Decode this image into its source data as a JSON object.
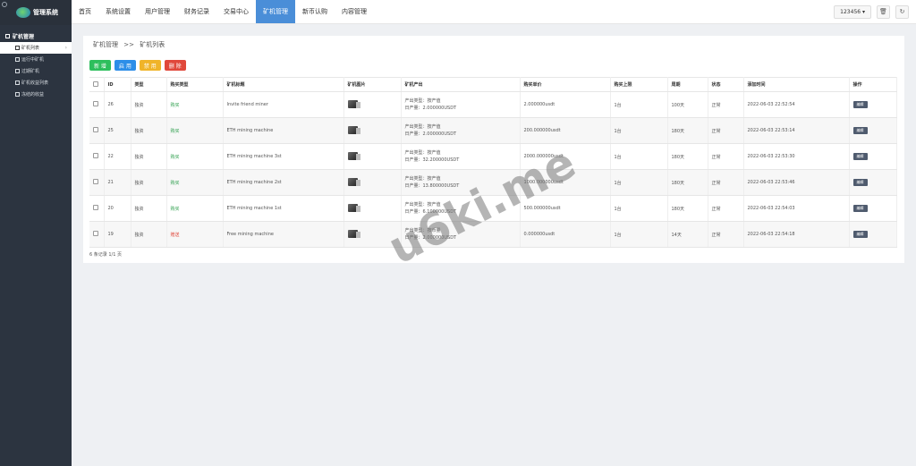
{
  "brand": {
    "title": "管理系统"
  },
  "sidebar": {
    "group": "矿机管理",
    "items": [
      {
        "label": "矿机列表",
        "active": true
      },
      {
        "label": "运行中矿机"
      },
      {
        "label": "过期矿机"
      },
      {
        "label": "矿机收益列表"
      },
      {
        "label": "冻结的收益"
      }
    ]
  },
  "topnav": {
    "items": [
      "首页",
      "系统设置",
      "用户管理",
      "财务记录",
      "交易中心",
      "矿机管理",
      "新币认购",
      "内容管理"
    ],
    "active_index": 5,
    "user": "123456 ▾"
  },
  "breadcrumb": {
    "root": "矿机管理",
    "sep": ">>",
    "current": "矿机列表"
  },
  "buttons": {
    "add": "新 增",
    "enable": "启 用",
    "disable": "禁 用",
    "delete": "删 除"
  },
  "table": {
    "headers": [
      "ID",
      "类型",
      "购买类型",
      "矿机标题",
      "矿机图片",
      "矿机产出",
      "购买单价",
      "购买上限",
      "周期",
      "状态",
      "添加时间",
      "操作"
    ],
    "rows": [
      {
        "id": "26",
        "type": "独资",
        "buy_type": "购买",
        "buy_color": "green",
        "title": "Invite friend miner",
        "out_kind": "产出类型：按产值",
        "out_daily": "日产量：2.000000USDT",
        "price": "2.000000usdt",
        "limit": "1台",
        "period": "100天",
        "status": "正常",
        "time": "2022-06-03 22:52:54",
        "action": "编辑"
      },
      {
        "id": "25",
        "type": "独资",
        "buy_type": "购买",
        "buy_color": "green",
        "title": "ETH mining machine",
        "out_kind": "产出类型：按产值",
        "out_daily": "日产量：2.000000USDT",
        "price": "200.000000usdt",
        "limit": "1台",
        "period": "180天",
        "status": "正常",
        "time": "2022-06-03 22:53:14",
        "action": "编辑"
      },
      {
        "id": "22",
        "type": "独资",
        "buy_type": "购买",
        "buy_color": "green",
        "title": "ETH mining machine 3st",
        "out_kind": "产出类型：按产值",
        "out_daily": "日产量：32.200000USDT",
        "price": "2000.000000usdt",
        "limit": "1台",
        "period": "180天",
        "status": "正常",
        "time": "2022-06-03 22:53:30",
        "action": "编辑"
      },
      {
        "id": "21",
        "type": "独资",
        "buy_type": "购买",
        "buy_color": "green",
        "title": "ETH mining machine 2st",
        "out_kind": "产出类型：按产值",
        "out_daily": "日产量：13.800000USDT",
        "price": "1000.000000usdt",
        "limit": "1台",
        "period": "180天",
        "status": "正常",
        "time": "2022-06-03 22:53:46",
        "action": "编辑"
      },
      {
        "id": "20",
        "type": "独资",
        "buy_type": "购买",
        "buy_color": "green",
        "title": "ETH mining machine 1st",
        "out_kind": "产出类型：按产值",
        "out_daily": "日产量：6.100000USDT",
        "price": "500.000000usdt",
        "limit": "1台",
        "period": "180天",
        "status": "正常",
        "time": "2022-06-03 22:54:03",
        "action": "编辑"
      },
      {
        "id": "19",
        "type": "独资",
        "buy_type": "赠送",
        "buy_color": "red",
        "title": "Free mining machine",
        "out_kind": "产出类型：按币量",
        "out_daily": "日产量：2.000000USDT",
        "price": "0.000000usdt",
        "limit": "1台",
        "period": "14天",
        "status": "正常",
        "time": "2022-06-03 22:54:18",
        "action": "编辑"
      }
    ]
  },
  "footer_info": "6 条记录 1/1 页",
  "watermark": "u6ki.me",
  "colors": {
    "sidebar": "#2c3440",
    "nav_active": "#4a8ed8",
    "green": "#2a9d4a",
    "red": "#e0483b"
  }
}
